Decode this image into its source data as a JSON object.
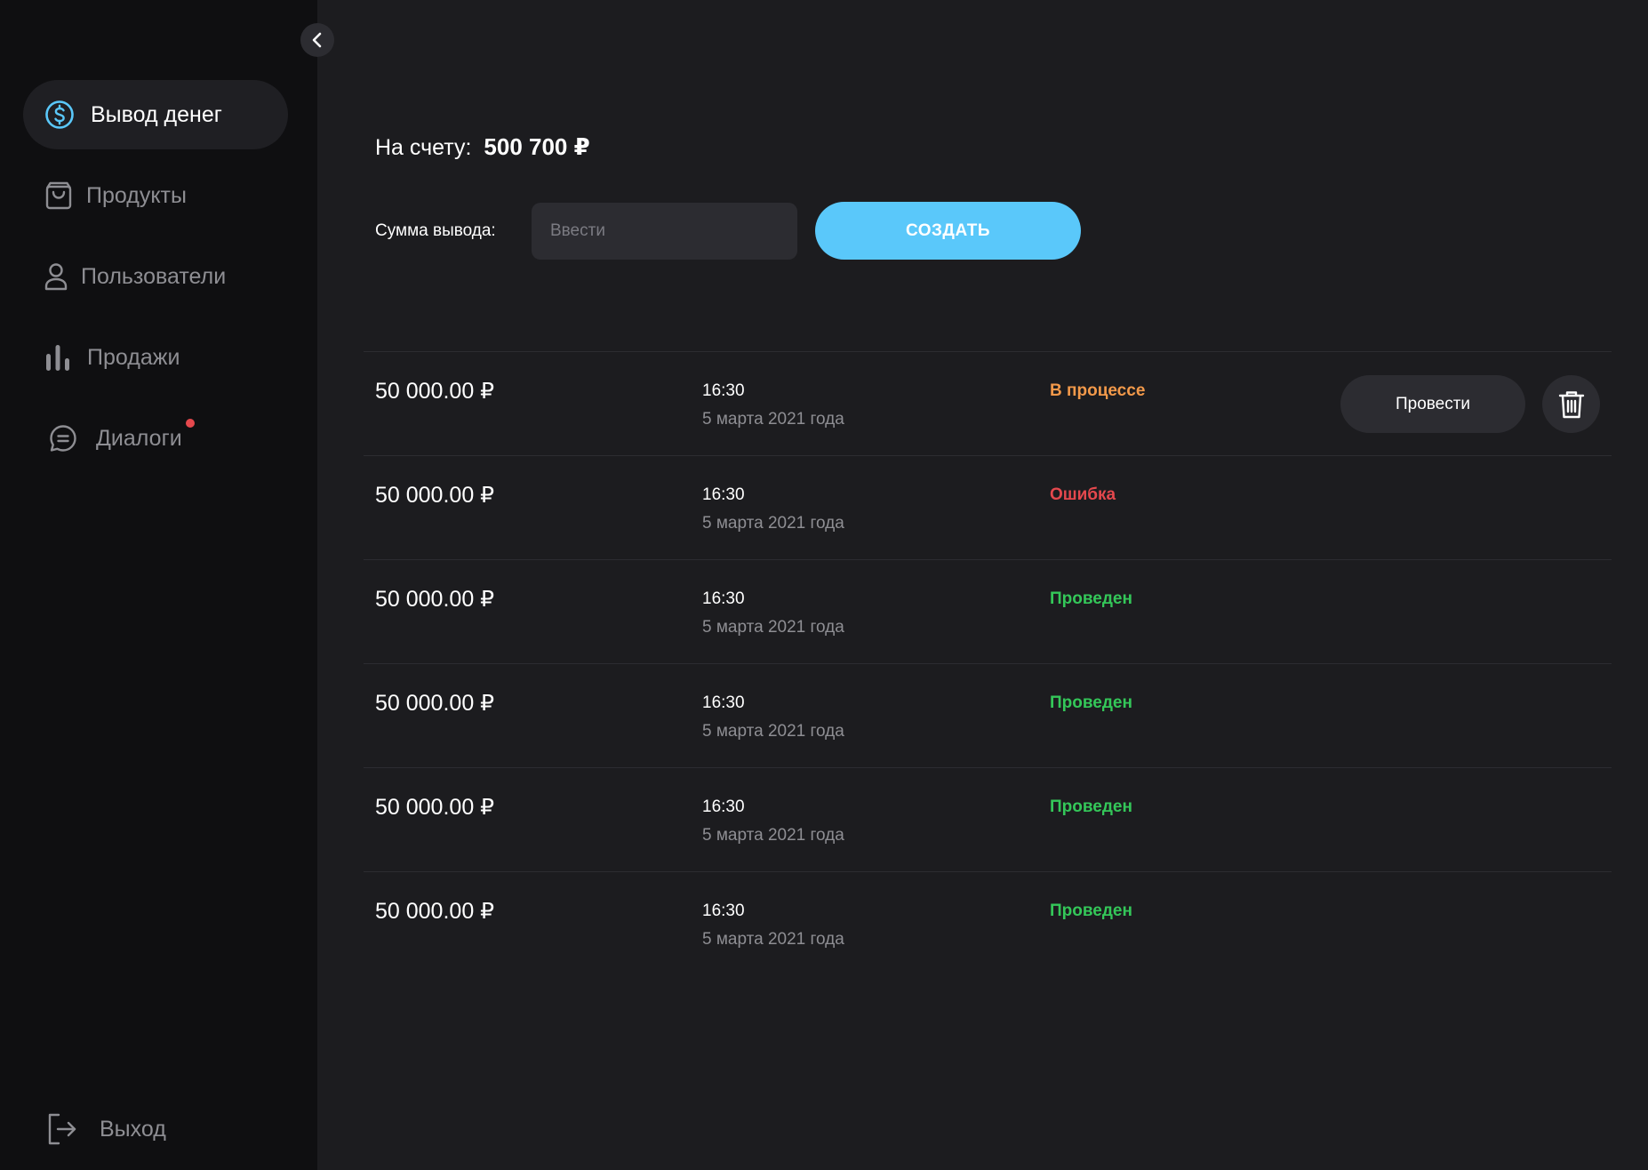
{
  "sidebar": {
    "items": [
      {
        "label": "Вывод денег",
        "icon": "dollar-circle-icon",
        "active": true
      },
      {
        "label": "Продукты",
        "icon": "shopping-bag-icon"
      },
      {
        "label": "Пользователи",
        "icon": "user-icon"
      },
      {
        "label": "Продажи",
        "icon": "bar-chart-icon"
      },
      {
        "label": "Диалоги",
        "icon": "chat-icon",
        "has_notification": true
      }
    ],
    "logout_label": "Выход",
    "colors": {
      "accent": "#5ac8fa",
      "notification": "#e5484d"
    }
  },
  "balance": {
    "label": "На счету:",
    "value": "500 700 ₽"
  },
  "withdraw": {
    "label": "Сумма вывода:",
    "placeholder": "Ввести",
    "button_label": "СОЗДАТЬ"
  },
  "transactions": [
    {
      "amount": "50 000.00 ₽",
      "time": "16:30",
      "date": "5 марта 2021 года",
      "status": "В процессе",
      "status_color": "#f2994a",
      "action_label": "Провести"
    },
    {
      "amount": "50 000.00 ₽",
      "time": "16:30",
      "date": "5 марта 2021 года",
      "status": "Ошибка",
      "status_color": "#e5484d"
    },
    {
      "amount": "50 000.00 ₽",
      "time": "16:30",
      "date": "5 марта 2021 года",
      "status": "Проведен",
      "status_color": "#34c759"
    },
    {
      "amount": "50 000.00 ₽",
      "time": "16:30",
      "date": "5 марта 2021 года",
      "status": "Проведен",
      "status_color": "#34c759"
    },
    {
      "amount": "50 000.00 ₽",
      "time": "16:30",
      "date": "5 марта 2021 года",
      "status": "Проведен",
      "status_color": "#34c759"
    },
    {
      "amount": "50 000.00 ₽",
      "time": "16:30",
      "date": "5 марта 2021 года",
      "status": "Проведен",
      "status_color": "#34c759"
    }
  ]
}
